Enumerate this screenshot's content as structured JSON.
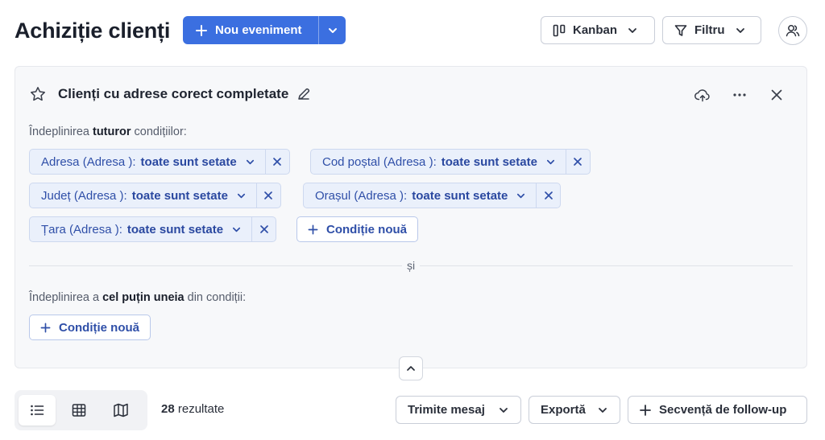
{
  "header": {
    "title": "Achiziție clienți",
    "new_event_label": "Nou eveniment",
    "kanban_label": "Kanban",
    "filter_label": "Filtru"
  },
  "segment": {
    "name": "Clienți cu adrese corect completate",
    "all_group": {
      "intro_pre": "Îndeplinirea ",
      "intro_bold": "tuturor",
      "intro_post": " condițiilor:",
      "conditions": [
        {
          "field": "Adresa (Adresa ):",
          "value": "toate sunt setate"
        },
        {
          "field": "Cod poștal (Adresa ):",
          "value": "toate sunt setate"
        },
        {
          "field": "Județ (Adresa ):",
          "value": "toate sunt setate"
        },
        {
          "field": "Orașul (Adresa ):",
          "value": "toate sunt setate"
        },
        {
          "field": "Țara (Adresa ):",
          "value": "toate sunt setate"
        }
      ],
      "add_label": "Condiție nouă"
    },
    "joiner": "și",
    "any_group": {
      "intro_pre": "Îndeplinirea a ",
      "intro_bold": "cel puțin uneia",
      "intro_post": " din condiții:",
      "add_label": "Condiție nouă"
    }
  },
  "footer": {
    "results_count": "28",
    "results_label": " rezultate",
    "send_message_label": "Trimite mesaj",
    "export_label": "Exportă",
    "sequence_label": "Secvență de follow-up",
    "active_view": "list"
  },
  "colors": {
    "primary": "#3b6fe0",
    "chip_bg": "#eaf0fb",
    "chip_text": "#2f4fa8",
    "panel_bg": "#f7f8fa"
  }
}
